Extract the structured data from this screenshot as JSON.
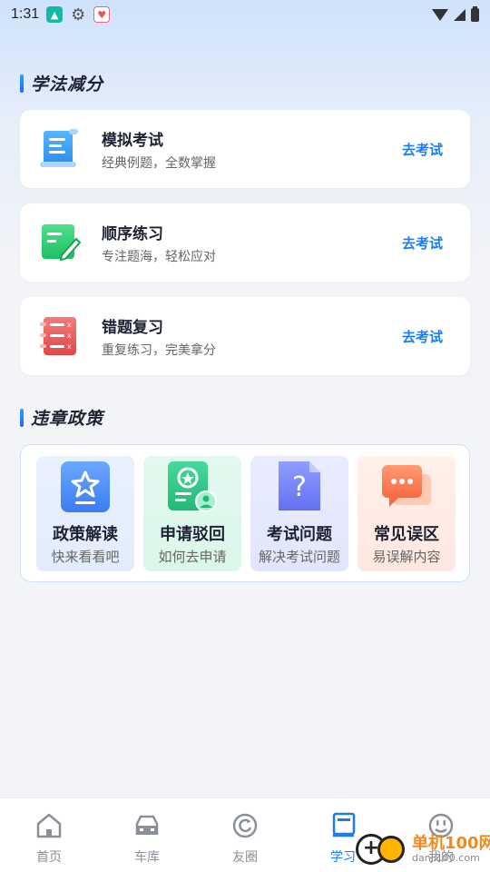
{
  "status_bar": {
    "time": "1:31"
  },
  "sections": {
    "study": {
      "title": "学法减分"
    },
    "policy": {
      "title": "违章政策"
    }
  },
  "study_cards": [
    {
      "title": "模拟考试",
      "subtitle": "经典例题，全数掌握",
      "action": "去考试",
      "icon": "scroll-document-icon"
    },
    {
      "title": "顺序练习",
      "subtitle": "专注题海，轻松应对",
      "action": "去考试",
      "icon": "edit-pencil-icon"
    },
    {
      "title": "错题复习",
      "subtitle": "重复练习，完美拿分",
      "action": "去考试",
      "icon": "wrong-list-icon"
    }
  ],
  "policy_items": [
    {
      "title": "政策解读",
      "subtitle": "快来看看吧",
      "icon": "star-badge-icon"
    },
    {
      "title": "申请驳回",
      "subtitle": "如何去申请",
      "icon": "user-document-icon"
    },
    {
      "title": "考试问题",
      "subtitle": "解决考试问题",
      "icon": "question-document-icon"
    },
    {
      "title": "常见误区",
      "subtitle": "易误解内容",
      "icon": "chat-bubble-icon"
    }
  ],
  "bottom_nav": [
    {
      "label": "首页",
      "icon": "home-icon",
      "active": false
    },
    {
      "label": "车库",
      "icon": "car-icon",
      "active": false
    },
    {
      "label": "友圈",
      "icon": "refresh-circle-icon",
      "active": false
    },
    {
      "label": "学习",
      "icon": "book-icon",
      "active": true
    },
    {
      "label": "我的",
      "icon": "smile-icon",
      "active": false
    }
  ],
  "watermark": {
    "text": "单机100网",
    "url": "danji100.com"
  },
  "colors": {
    "accent": "#1a7cf5",
    "background": "#f3f4f8"
  }
}
